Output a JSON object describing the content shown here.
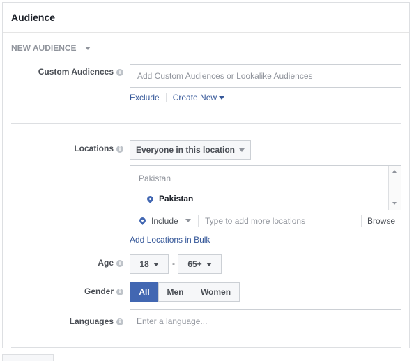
{
  "panel": {
    "title": "Audience"
  },
  "audience_dropdown": {
    "label": "NEW AUDIENCE"
  },
  "custom_audiences": {
    "label": "Custom Audiences",
    "placeholder": "Add Custom Audiences or Lookalike Audiences",
    "exclude_link": "Exclude",
    "create_new_link": "Create New"
  },
  "locations": {
    "label": "Locations",
    "scope_dropdown": "Everyone in this location",
    "list_header": "Pakistan",
    "selected_items": [
      "Pakistan"
    ],
    "include_dropdown": "Include",
    "search_placeholder": "Type to add more locations",
    "browse_link": "Browse",
    "bulk_link": "Add Locations in Bulk"
  },
  "age": {
    "label": "Age",
    "min": "18",
    "separator": "-",
    "max": "65+"
  },
  "gender": {
    "label": "Gender",
    "options": [
      "All",
      "Men",
      "Women"
    ],
    "selected": "All"
  },
  "languages": {
    "label": "Languages",
    "placeholder": "Enter a language..."
  },
  "colors": {
    "accent": "#4267b2",
    "link": "#365899",
    "border": "#ccd0d5"
  },
  "icons": {
    "info": "info-icon",
    "location": "location-pin-icon",
    "dropdown": "caret-down-icon"
  }
}
